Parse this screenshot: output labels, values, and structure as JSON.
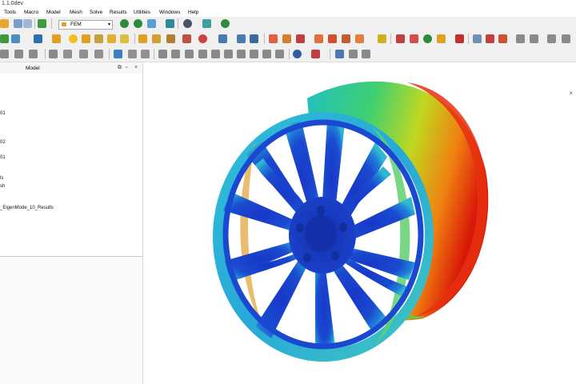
{
  "window": {
    "title": "1.1.0dev"
  },
  "menu": [
    "Tools",
    "Macro",
    "Model",
    "Mesh",
    "Solve",
    "Results",
    "Utilities",
    "Windows",
    "Help"
  ],
  "toolbar": {
    "workbench": "FEM"
  },
  "panel": {
    "title": "Model",
    "tree": [
      "01",
      "02",
      "01",
      "ls",
      "sh",
      "_EigenMode_10_Results"
    ]
  },
  "colors": {
    "result_min": "#1030c0",
    "result_mid": "#20c0c0",
    "result_high": "#30d040",
    "result_max": "#e02010"
  }
}
